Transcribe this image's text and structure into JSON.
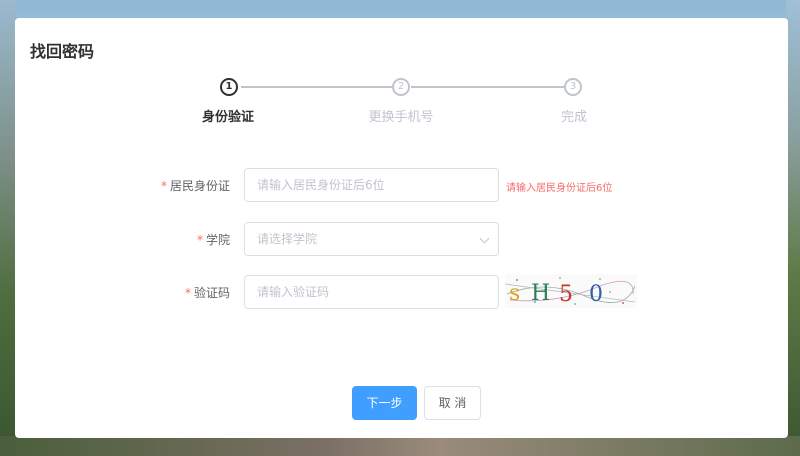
{
  "dialog": {
    "title": "找回密码"
  },
  "steps": [
    {
      "number": "1",
      "label": "身份验证",
      "active": true
    },
    {
      "number": "2",
      "label": "更换手机号",
      "active": false
    },
    {
      "number": "3",
      "label": "完成",
      "active": false
    }
  ],
  "form": {
    "required_mark": "*",
    "id_label": "居民身份证",
    "id_placeholder": "请输入居民身份证后6位",
    "id_error": "请输入居民身份证后6位",
    "college_label": "学院",
    "college_placeholder": "请选择学院",
    "captcha_label": "验证码",
    "captcha_placeholder": "请输入验证码",
    "captcha_text": "sH50"
  },
  "buttons": {
    "next_label": "下一步",
    "cancel_label": "取 消"
  },
  "colors": {
    "primary": "#409eff",
    "error": "#f56c6c",
    "text": "#303133",
    "placeholder": "#c0c4cc"
  }
}
